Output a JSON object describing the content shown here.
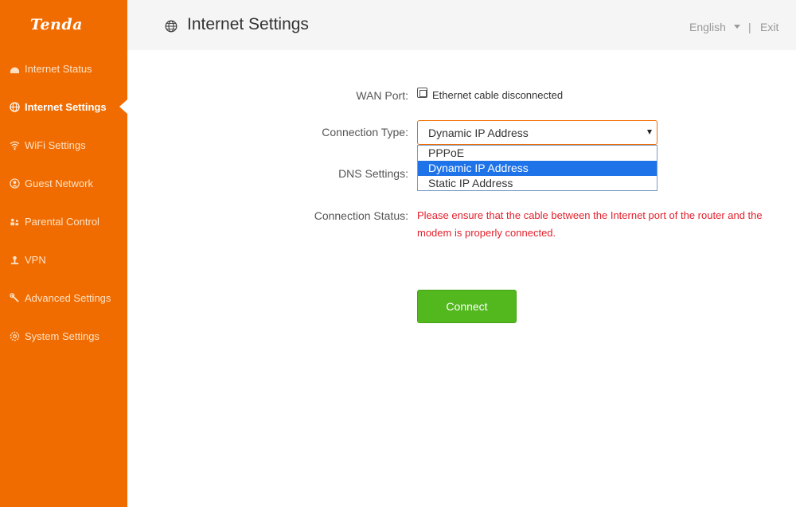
{
  "brand": {
    "logo_text": "Tenda",
    "accent_color": "#f06c00"
  },
  "sidebar": {
    "items": [
      {
        "label": "Internet Status",
        "icon": "dashboard-icon",
        "active": false
      },
      {
        "label": "Internet Settings",
        "icon": "globe-icon",
        "active": true
      },
      {
        "label": "WiFi Settings",
        "icon": "wifi-icon",
        "active": false
      },
      {
        "label": "Guest Network",
        "icon": "guest-network-icon",
        "active": false
      },
      {
        "label": "Parental Control",
        "icon": "parental-control-icon",
        "active": false
      },
      {
        "label": "VPN",
        "icon": "vpn-icon",
        "active": false
      },
      {
        "label": "Advanced Settings",
        "icon": "wrench-icon",
        "active": false
      },
      {
        "label": "System Settings",
        "icon": "gear-icon",
        "active": false
      }
    ]
  },
  "header": {
    "title": "Internet Settings",
    "language": "English",
    "separator": "|",
    "exit_label": "Exit"
  },
  "form": {
    "wan_port_label": "WAN Port:",
    "wan_port_status": "Ethernet cable disconnected",
    "connection_type_label": "Connection Type:",
    "connection_type_value": "Dynamic IP Address",
    "connection_type_options": [
      "PPPoE",
      "Dynamic IP Address",
      "Static IP Address"
    ],
    "dns_settings_label": "DNS Settings:",
    "connection_status_label": "Connection Status:",
    "connection_status_message": "Please ensure that the cable between the Internet port of the router and the modem is properly connected.",
    "connect_button": "Connect"
  },
  "colors": {
    "error": "#e3202c",
    "button": "#52b81e",
    "selection": "#1e73e8"
  }
}
